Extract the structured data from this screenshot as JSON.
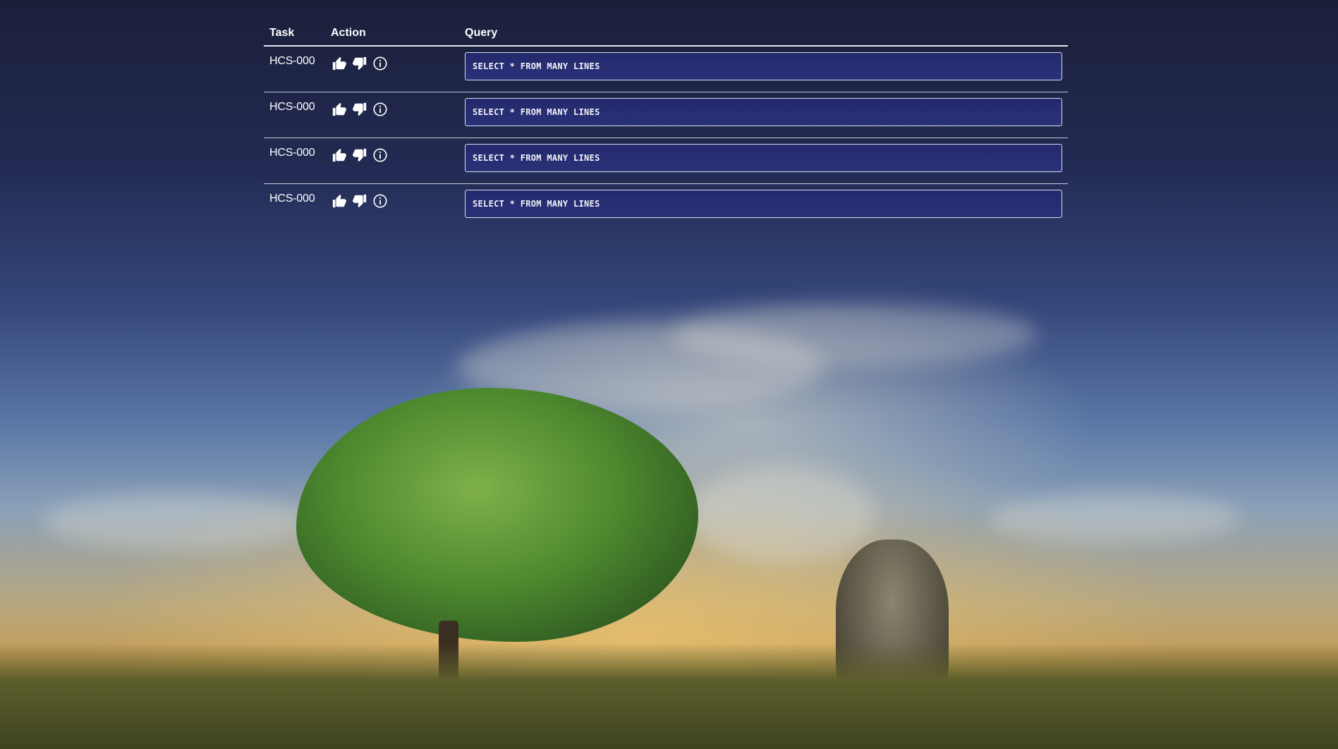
{
  "table": {
    "headers": {
      "task": "Task",
      "action": "Action",
      "query": "Query"
    },
    "rows": [
      {
        "task": "HCS-000",
        "query": "SELECT * FROM MANY LINES"
      },
      {
        "task": "HCS-000",
        "query": "SELECT * FROM MANY LINES"
      },
      {
        "task": "HCS-000",
        "query": "SELECT * FROM MANY LINES"
      },
      {
        "task": "HCS-000",
        "query": "SELECT * FROM MANY LINES"
      }
    ]
  },
  "icons": {
    "like": "thumbs-up-icon",
    "dislike": "thumbs-down-icon",
    "info": "info-icon"
  },
  "colors": {
    "query_box_bg": "#262d70",
    "text": "#ffffff"
  }
}
